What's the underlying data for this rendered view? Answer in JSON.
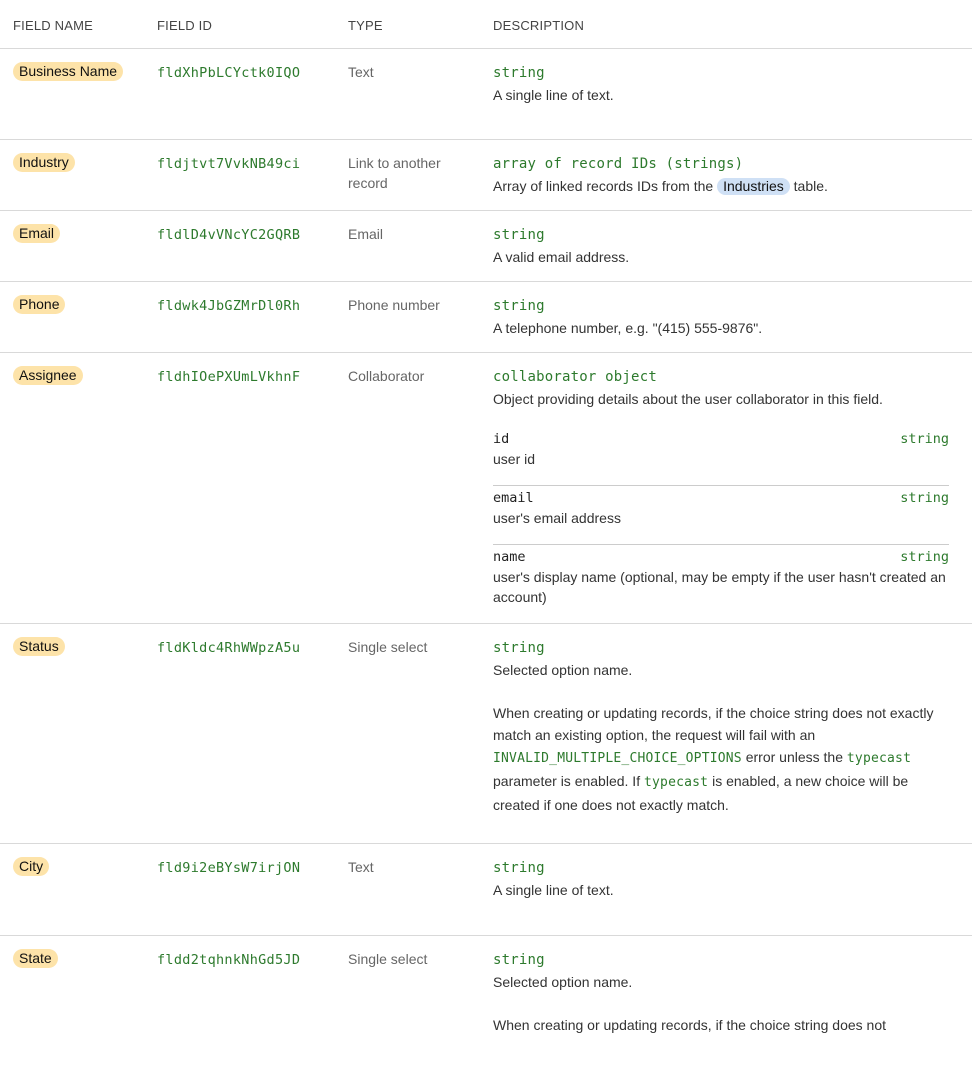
{
  "columns": {
    "name": "FIELD NAME",
    "id": "FIELD ID",
    "type": "TYPE",
    "description": "DESCRIPTION"
  },
  "rows": [
    {
      "name": "Business Name",
      "id": "fldXhPbLCYctk0IQO",
      "type": "Text",
      "dtype": "string",
      "desc": "A single line of text."
    },
    {
      "name": "Industry",
      "id": "fldjtvt7VvkNB49ci",
      "type": "Link to another record",
      "dtype": "array of record IDs (strings)",
      "desc_before": "Array of linked records IDs from the",
      "desc_table": "Industries",
      "desc_after": "table."
    },
    {
      "name": "Email",
      "id": "fldlD4vVNcYC2GQRB",
      "type": "Email",
      "dtype": "string",
      "desc": "A valid email address."
    },
    {
      "name": "Phone",
      "id": "fldwk4JbGZMrDl0Rh",
      "type": "Phone number",
      "dtype": "string",
      "desc": "A telephone number, e.g. \"(415) 555-9876\"."
    },
    {
      "name": "Assignee",
      "id": "fldhIOePXUmLVkhnF",
      "type": "Collaborator",
      "dtype": "collaborator object",
      "desc": "Object providing details about the user collaborator in this field.",
      "subfields": [
        {
          "key": "id",
          "type": "string",
          "desc": "user id"
        },
        {
          "key": "email",
          "type": "string",
          "desc": "user's email address"
        },
        {
          "key": "name",
          "type": "string",
          "desc": "user's display name (optional, may be empty if the user hasn't created an account)"
        }
      ]
    },
    {
      "name": "Status",
      "id": "fldKldc4RhWWpzA5u",
      "type": "Single select",
      "dtype": "string",
      "desc": "Selected option name.",
      "note_1": "When creating or updating records, if the choice string does not exactly match an existing option, the request will fail with an",
      "note_code_1": "INVALID_MULTIPLE_CHOICE_OPTIONS",
      "note_2": "error unless the",
      "note_code_2": "typecast",
      "note_3": "parameter is enabled. If",
      "note_code_3": "typecast",
      "note_4": "is enabled, a new choice will be created if one does not exactly match."
    },
    {
      "name": "City",
      "id": "fld9i2eBYsW7irjON",
      "type": "Text",
      "dtype": "string",
      "desc": "A single line of text."
    },
    {
      "name": "State",
      "id": "fldd2tqhnkNhGd5JD",
      "type": "Single select",
      "dtype": "string",
      "desc": "Selected option name.",
      "note_1": "When creating or updating records, if the choice string does not"
    }
  ]
}
